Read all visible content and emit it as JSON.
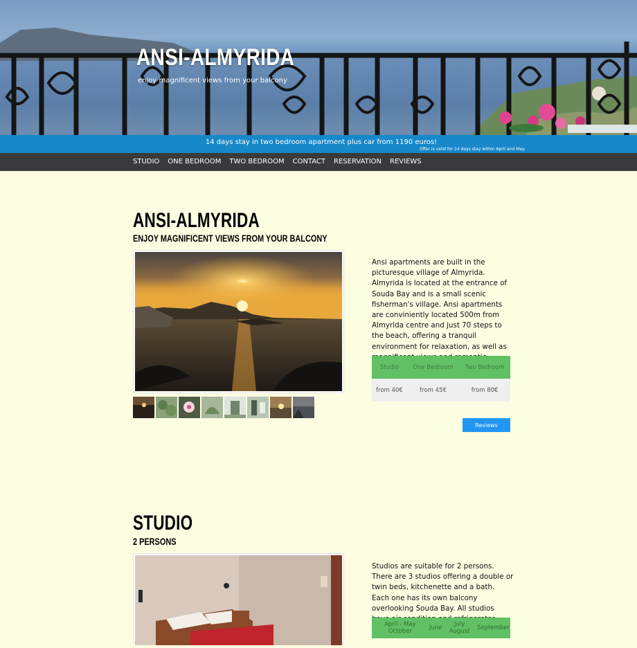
{
  "hero": {
    "title": "ANSI-ALMYRIDA",
    "subtitle": "enjoy magnificent views from your balcony"
  },
  "offer": {
    "main": "14 days stay in two bedroom apartment plus car from 1190 euros!",
    "note": "Offer is valid for 14 days stay within April and May."
  },
  "nav": {
    "items": [
      "STUDIO",
      "ONE BEDROOM",
      "TWO BEDROOM",
      "CONTACT",
      "RESERVATION",
      "REVIEWS"
    ]
  },
  "intro": {
    "title": "ANSI-ALMYRIDA",
    "subtitle": "ENJOY MAGNIFICENT VIEWS FROM YOUR BALCONY",
    "description": "Ansi apartments are built in the picturesque village of Almyrida. Almyrida is located at the entrance of Souda Bay and is a small scenic fisherman's village. Ansi apartments are conviniently located 500m from Almyrida centre and just 70 steps to the beach, offering a tranquil environment for relaxation, as well as magnificent views and romantic sunsets from your balcony..",
    "price_headers": [
      "Studio",
      "One Bedroom",
      "Two Bedroom"
    ],
    "prices": [
      "from 40€",
      "from 45€",
      "from 80€"
    ],
    "reviews_button": "Reviews",
    "thumbnails": [
      "sunset",
      "garden",
      "flower",
      "plant",
      "balcony-door",
      "apartment-entrance",
      "sunset-2",
      "bay-view"
    ]
  },
  "studio": {
    "title": "STUDIO",
    "subtitle": "2 PERSONS",
    "description": "Studios are suitable for 2 persons. There are 3 studios offering a double or twin beds, kitchenette and a bath. Each one has its own balcony overlooking Souda Bay. All studios have air condition and refrigerator.",
    "season_headers": [
      "April - May October",
      "June",
      "July August",
      "September"
    ]
  },
  "colors": {
    "page_bg": "#fdfde2",
    "offer_bar": "#1788c9",
    "nav_bar": "#3a3a3d",
    "table_header": "#62c065",
    "table_cell": "#efefef",
    "button": "#2196f3"
  }
}
